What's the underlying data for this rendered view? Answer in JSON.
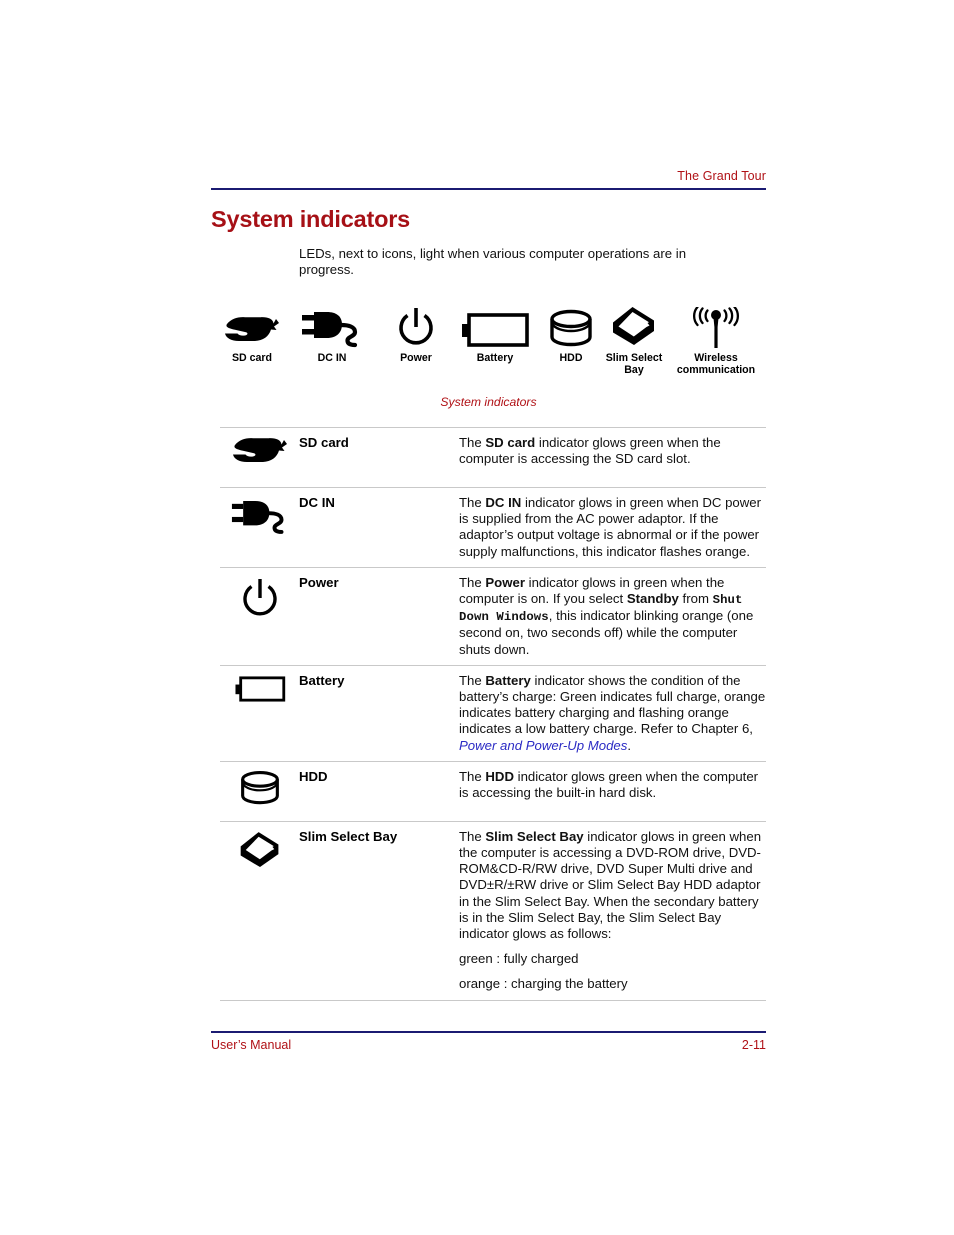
{
  "header": {
    "chapter": "The Grand Tour",
    "rule_color": "#1b1b72"
  },
  "title": "System indicators",
  "intro": "LEDs, next to icons, light when various computer operations are in progress.",
  "figure": {
    "caption": "System indicators",
    "caption_color": "#b01116",
    "icons": [
      {
        "name": "sd-card-icon",
        "label": "SD card"
      },
      {
        "name": "dc-in-plug-icon",
        "label": "DC IN"
      },
      {
        "name": "power-icon",
        "label": "Power"
      },
      {
        "name": "battery-icon",
        "label": "Battery"
      },
      {
        "name": "hdd-icon",
        "label": "HDD"
      },
      {
        "name": "slim-select-bay-icon",
        "label": "Slim Select\nBay"
      },
      {
        "name": "wireless-communication-icon",
        "label": "Wireless\ncommunication"
      }
    ]
  },
  "table": {
    "rows": [
      {
        "icon": "sd-card-icon",
        "name": "SD card",
        "desc_html": "The <span class=\"b\">SD card</span> indicator glows green when the computer is accessing the SD card slot."
      },
      {
        "icon": "dc-in-plug-icon",
        "name": "DC IN",
        "desc_html": "The <span class=\"b\">DC IN</span> indicator glows in green when DC power is supplied from the AC power adaptor. If the adaptor’s output voltage is abnormal or if the power supply malfunctions, this indicator flashes orange."
      },
      {
        "icon": "power-icon",
        "name": "Power",
        "desc_html": "The <span class=\"b\">Power</span> indicator glows in green when the computer is on. If you select <span class=\"b\">Standby</span> from <span class=\"mono\">Shut Down Windows</span>, this indicator blinking orange (one second on, two seconds off) while the computer shuts down."
      },
      {
        "icon": "battery-icon",
        "name": "Battery",
        "desc_html": "The <span class=\"b\">Battery</span> indicator shows the condition of the battery’s charge: Green indicates full charge, orange indicates battery charging and flashing orange indicates a low battery charge. Refer to Chapter 6, <span class=\"link\">Power and Power-Up Modes</span>."
      },
      {
        "icon": "hdd-icon",
        "name": "HDD",
        "desc_html": "The <span class=\"b\">HDD</span> indicator glows green when the computer is accessing the built-in hard disk."
      },
      {
        "icon": "slim-select-bay-icon",
        "name": "Slim Select Bay",
        "desc_html": "<p>The <span class=\"b\">Slim Select Bay</span> indicator glows in green when the computer is accessing a DVD-ROM drive, DVD-ROM&amp;CD-R/RW drive, DVD Super Multi drive and DVD±R/±RW drive or Slim Select Bay HDD adaptor in the Slim Select Bay. When the secondary battery is in the Slim Select Bay, the Slim Select Bay indicator glows as follows:</p><p>green : fully charged</p><p>orange : charging the battery</p>"
      }
    ]
  },
  "footer": {
    "left": "User’s Manual",
    "right": "2-11",
    "rule_color": "#1b1b72"
  }
}
